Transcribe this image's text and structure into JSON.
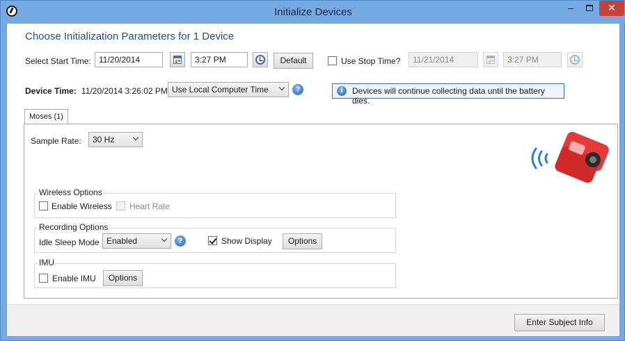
{
  "window": {
    "title": "Initialize Devices",
    "minimize": "–",
    "close": "✕"
  },
  "heading": "Choose Initialization Parameters for 1 Device",
  "start": {
    "label": "Select Start Time:",
    "date": "11/20/2014",
    "time": "3:27 PM",
    "default_button": "Default"
  },
  "stop": {
    "label": "Use Stop Time?",
    "checked": false,
    "date": "11/21/2014",
    "time": "3:27 PM"
  },
  "device_time": {
    "label": "Device Time:",
    "value": "11/20/2014 3:26:02 PM",
    "source_selected": "Use Local Computer Time"
  },
  "info": {
    "icon_glyph": "i",
    "message": "Devices will continue collecting data until the battery dies."
  },
  "help_glyph": "?",
  "tab": {
    "label": "Moses (1)"
  },
  "sample_rate": {
    "label": "Sample Rate:",
    "selected": "30 Hz"
  },
  "wireless": {
    "title": "Wireless Options",
    "enable_wireless": "Enable Wireless",
    "heart_rate": "Heart Rate"
  },
  "recording": {
    "title": "Recording Options",
    "idle_sleep_label": "Idle Sleep Mode",
    "idle_sleep_selected": "Enabled",
    "show_display": "Show Display",
    "show_display_checked": true,
    "options_button": "Options"
  },
  "imu": {
    "title": "IMU",
    "enable_imu": "Enable IMU",
    "options_button": "Options"
  },
  "footer": {
    "enter_subject_button": "Enter Subject Info"
  },
  "colors": {
    "titlebar": "#75a9e3",
    "heading": "#1f4e8c",
    "close_button": "#c7413a",
    "device_red": "#e53a3a",
    "wireless_blue": "#2f7fd6"
  }
}
